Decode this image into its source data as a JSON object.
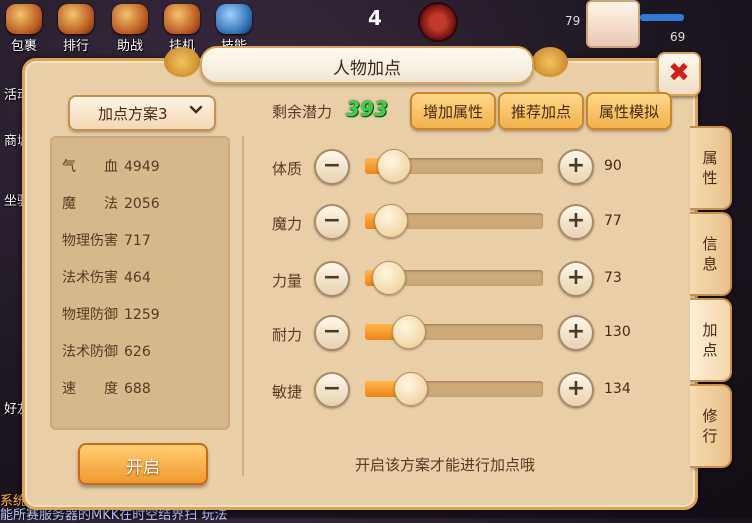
{
  "hud": {
    "top_buttons": [
      "包裹",
      "排行",
      "助战",
      "挂机",
      "技能"
    ],
    "left_buttons": [
      "活动",
      "商城",
      "坐骑",
      "好友"
    ],
    "center_number": "4",
    "party_values": [
      "79",
      "69"
    ],
    "bottom_line": {
      "channel": "系统",
      "text": "能所赛服务器的MKK在时空结界扫  玩法"
    }
  },
  "window": {
    "title": "人物加点",
    "close_glyph": "✖"
  },
  "scheme": {
    "selected": "加点方案3",
    "open_button": "开启"
  },
  "stats": [
    {
      "label": "气　　血",
      "value": "4949"
    },
    {
      "label": "魔　　法",
      "value": "2056"
    },
    {
      "label": "物理伤害",
      "value": "717"
    },
    {
      "label": "法术伤害",
      "value": "464"
    },
    {
      "label": "物理防御",
      "value": "1259"
    },
    {
      "label": "法术防御",
      "value": "626"
    },
    {
      "label": "速　　度",
      "value": "688"
    }
  ],
  "potential": {
    "label": "剩余潜力",
    "value": "393"
  },
  "top_buttons": {
    "add": "增加属性",
    "recommend": "推荐加点",
    "simulate": "属性模拟"
  },
  "attributes": [
    {
      "name": "体质",
      "value": "90",
      "level": 0.16
    },
    {
      "name": "魔力",
      "value": "77",
      "level": 0.14
    },
    {
      "name": "力量",
      "value": "73",
      "level": 0.13
    },
    {
      "name": "耐力",
      "value": "130",
      "level": 0.24
    },
    {
      "name": "敏捷",
      "value": "134",
      "level": 0.25
    }
  ],
  "buttons": {
    "minus": "−",
    "plus": "+"
  },
  "hint": "开启该方案才能进行加点哦",
  "side_tabs": [
    {
      "label": "属性",
      "active": false
    },
    {
      "label": "信息",
      "active": false
    },
    {
      "label": "加点",
      "active": true
    },
    {
      "label": "修行",
      "active": false
    }
  ],
  "colors": {
    "accent": "#f09a2e",
    "potential": "#38d24a",
    "close": "#d31e1e"
  }
}
